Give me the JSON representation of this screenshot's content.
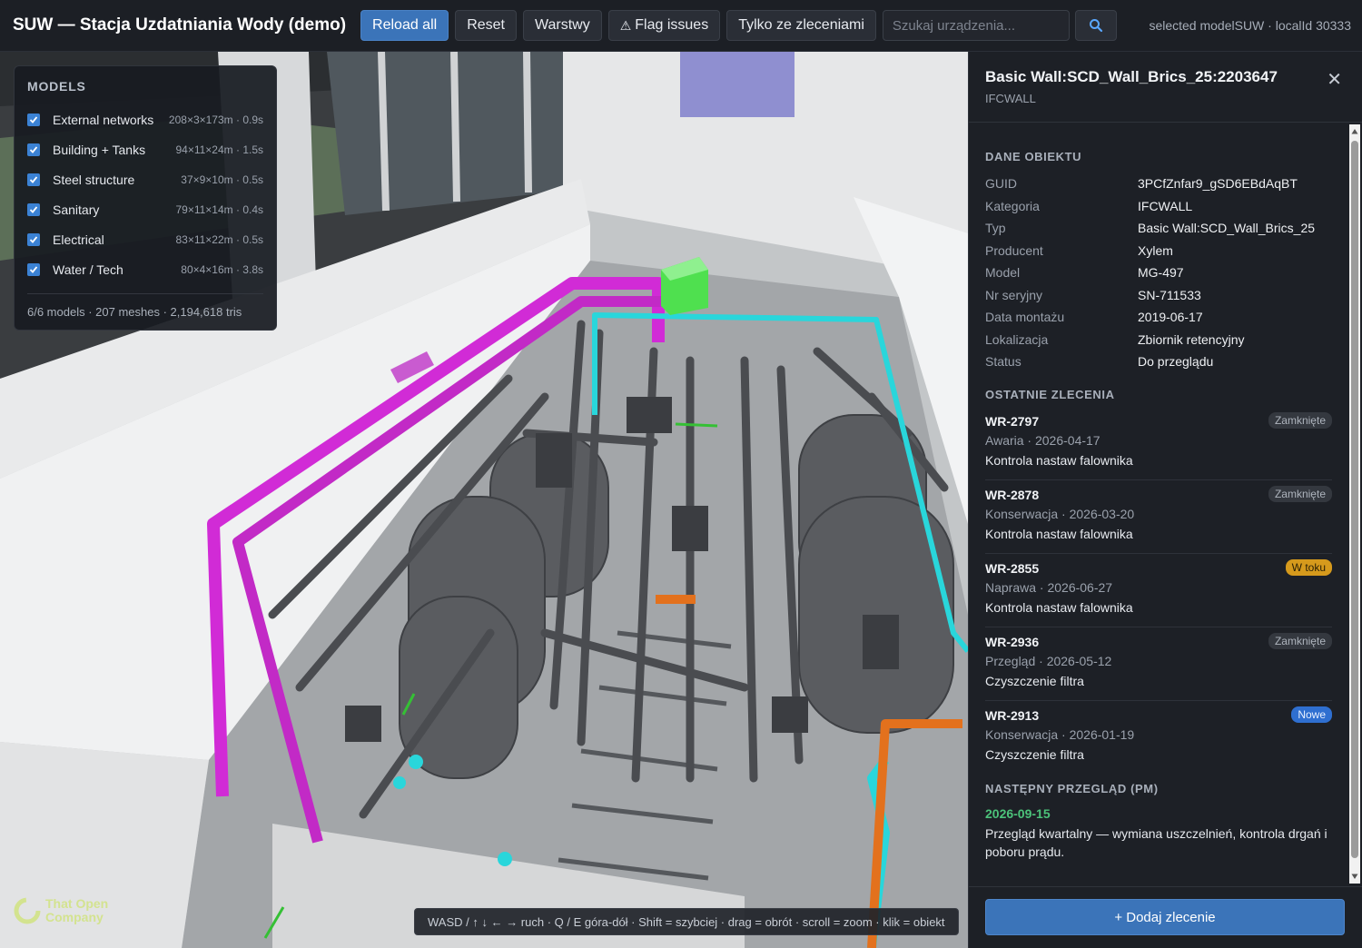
{
  "app": {
    "title": "SUW — Stacja Uzdatniania Wody (demo)",
    "info": "selected modelSUW · localId 30333"
  },
  "toolbar": {
    "reload_all": "Reload all",
    "reset": "Reset",
    "layers": "Warstwy",
    "flag_issues": "Flag issues",
    "flag_icon": "⚠",
    "with_orders": "Tylko ze zleceniami",
    "search_placeholder": "Szukaj urządzenia..."
  },
  "models": {
    "title": "MODELS",
    "items": [
      {
        "name": "External networks",
        "meta": "208×3×173m · 0.9s",
        "checked": true
      },
      {
        "name": "Building + Tanks",
        "meta": "94×11×24m · 1.5s",
        "checked": true
      },
      {
        "name": "Steel structure",
        "meta": "37×9×10m · 0.5s",
        "checked": true
      },
      {
        "name": "Sanitary",
        "meta": "79×11×14m · 0.4s",
        "checked": true
      },
      {
        "name": "Electrical",
        "meta": "83×11×22m · 0.5s",
        "checked": true
      },
      {
        "name": "Water / Tech",
        "meta": "80×4×16m · 3.8s",
        "checked": true
      }
    ],
    "footer": "6/6 models · 207 meshes · 2,194,618 tris"
  },
  "viewport": {
    "hint": "WASD / ↑ ↓ ← → ruch · Q / E góra-dół · Shift = szybciej · drag = obrót · scroll = zoom · klik = obiekt",
    "watermark_line1": "That Open",
    "watermark_line2": "Company"
  },
  "object": {
    "title": "Basic Wall:SCD_Wall_Brics_25:2203647",
    "class": "IFCWALL",
    "props_title": "DANE OBIEKTU",
    "props": [
      {
        "k": "GUID",
        "v": "3PCfZnfar9_gSD6EBdAqBT"
      },
      {
        "k": "Kategoria",
        "v": "IFCWALL"
      },
      {
        "k": "Typ",
        "v": "Basic Wall:SCD_Wall_Brics_25"
      },
      {
        "k": "Producent",
        "v": "Xylem"
      },
      {
        "k": "Model",
        "v": "MG-497"
      },
      {
        "k": "Nr seryjny",
        "v": "SN-711533"
      },
      {
        "k": "Data montażu",
        "v": "2019-06-17"
      },
      {
        "k": "Lokalizacja",
        "v": "Zbiornik retencyjny"
      },
      {
        "k": "Status",
        "v": "Do przeglądu"
      }
    ],
    "orders_title": "OSTATNIE ZLECENIA",
    "orders": [
      {
        "id": "WR-2797",
        "meta": "Awaria · 2026-04-17",
        "desc": "Kontrola nastaw falownika",
        "status": "Zamknięte",
        "kind": "closed"
      },
      {
        "id": "WR-2878",
        "meta": "Konserwacja · 2026-03-20",
        "desc": "Kontrola nastaw falownika",
        "status": "Zamknięte",
        "kind": "closed"
      },
      {
        "id": "WR-2855",
        "meta": "Naprawa · 2026-06-27",
        "desc": "Kontrola nastaw falownika",
        "status": "W toku",
        "kind": "progress"
      },
      {
        "id": "WR-2936",
        "meta": "Przegląd · 2026-05-12",
        "desc": "Czyszczenie filtra",
        "status": "Zamknięte",
        "kind": "closed"
      },
      {
        "id": "WR-2913",
        "meta": "Konserwacja · 2026-01-19",
        "desc": "Czyszczenie filtra",
        "status": "Nowe",
        "kind": "new"
      }
    ],
    "pm_title": "NASTĘPNY PRZEGLĄD (PM)",
    "pm_date": "2026-09-15",
    "pm_text": "Przegląd kwartalny — wymiana uszczelnień, kontrola drgań i poboru prądu.",
    "add_order": "+ Dodaj zlecenie",
    "close": "✕"
  },
  "colors": {
    "accent": "#3b74b9",
    "pipe_magenta": "#d12bd6",
    "pipe_cyan": "#29d6db",
    "pipe_orange": "#e3711d",
    "equipment_green": "#4fe04f",
    "status_progress": "#d69a1c",
    "status_new": "#2f6fd0",
    "pm_date": "#4cc27a"
  }
}
